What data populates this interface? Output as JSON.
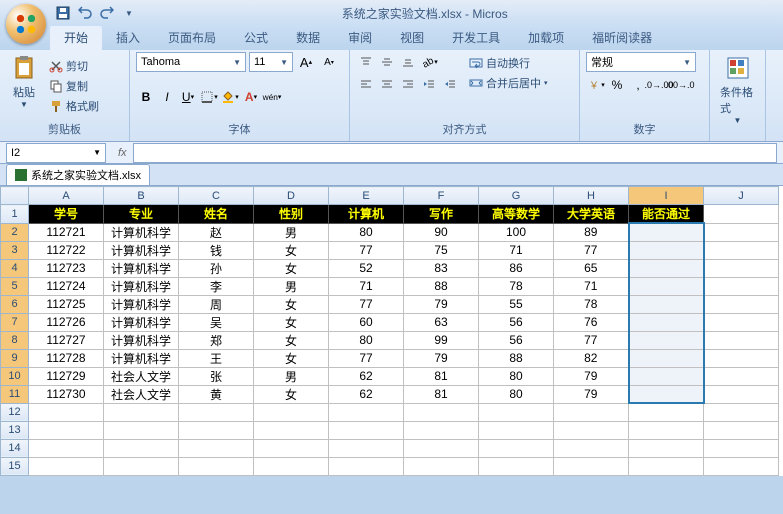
{
  "title": "系统之家实验文档.xlsx - Micros",
  "tabs": [
    "开始",
    "插入",
    "页面布局",
    "公式",
    "数据",
    "审阅",
    "视图",
    "开发工具",
    "加载项",
    "福昕阅读器"
  ],
  "activeTab": 0,
  "clipboard": {
    "label": "剪贴板",
    "paste": "粘贴",
    "cut": "剪切",
    "copy": "复制",
    "format": "格式刷"
  },
  "font": {
    "label": "字体",
    "name": "Tahoma",
    "size": "11"
  },
  "align": {
    "label": "对齐方式",
    "wrap": "自动换行",
    "merge": "合并后居中"
  },
  "number": {
    "label": "数字",
    "format": "常规"
  },
  "styles": {
    "label": "条件格式"
  },
  "namebox": "I2",
  "doctab": "系统之家实验文档.xlsx",
  "columns": [
    "A",
    "B",
    "C",
    "D",
    "E",
    "F",
    "G",
    "H",
    "I",
    "J"
  ],
  "headerRow": [
    "学号",
    "专业",
    "姓名",
    "性别",
    "计算机",
    "写作",
    "高等数学",
    "大学英语",
    "能否通过"
  ],
  "rows": [
    [
      "112721",
      "计算机科学",
      "赵",
      "男",
      "80",
      "90",
      "100",
      "89",
      ""
    ],
    [
      "112722",
      "计算机科学",
      "钱",
      "女",
      "77",
      "75",
      "71",
      "77",
      ""
    ],
    [
      "112723",
      "计算机科学",
      "孙",
      "女",
      "52",
      "83",
      "86",
      "65",
      ""
    ],
    [
      "112724",
      "计算机科学",
      "李",
      "男",
      "71",
      "88",
      "78",
      "71",
      ""
    ],
    [
      "112725",
      "计算机科学",
      "周",
      "女",
      "77",
      "79",
      "55",
      "78",
      ""
    ],
    [
      "112726",
      "计算机科学",
      "吴",
      "女",
      "60",
      "63",
      "56",
      "76",
      ""
    ],
    [
      "112727",
      "计算机科学",
      "郑",
      "女",
      "80",
      "99",
      "56",
      "77",
      ""
    ],
    [
      "112728",
      "计算机科学",
      "王",
      "女",
      "77",
      "79",
      "88",
      "82",
      ""
    ],
    [
      "112729",
      "社会人文学",
      "张",
      "男",
      "62",
      "81",
      "80",
      "79",
      ""
    ],
    [
      "112730",
      "社会人文学",
      "黄",
      "女",
      "62",
      "81",
      "80",
      "79",
      ""
    ]
  ],
  "totalRows": 15,
  "selectedCol": 8,
  "selRowStart": 2,
  "selRowEnd": 11
}
